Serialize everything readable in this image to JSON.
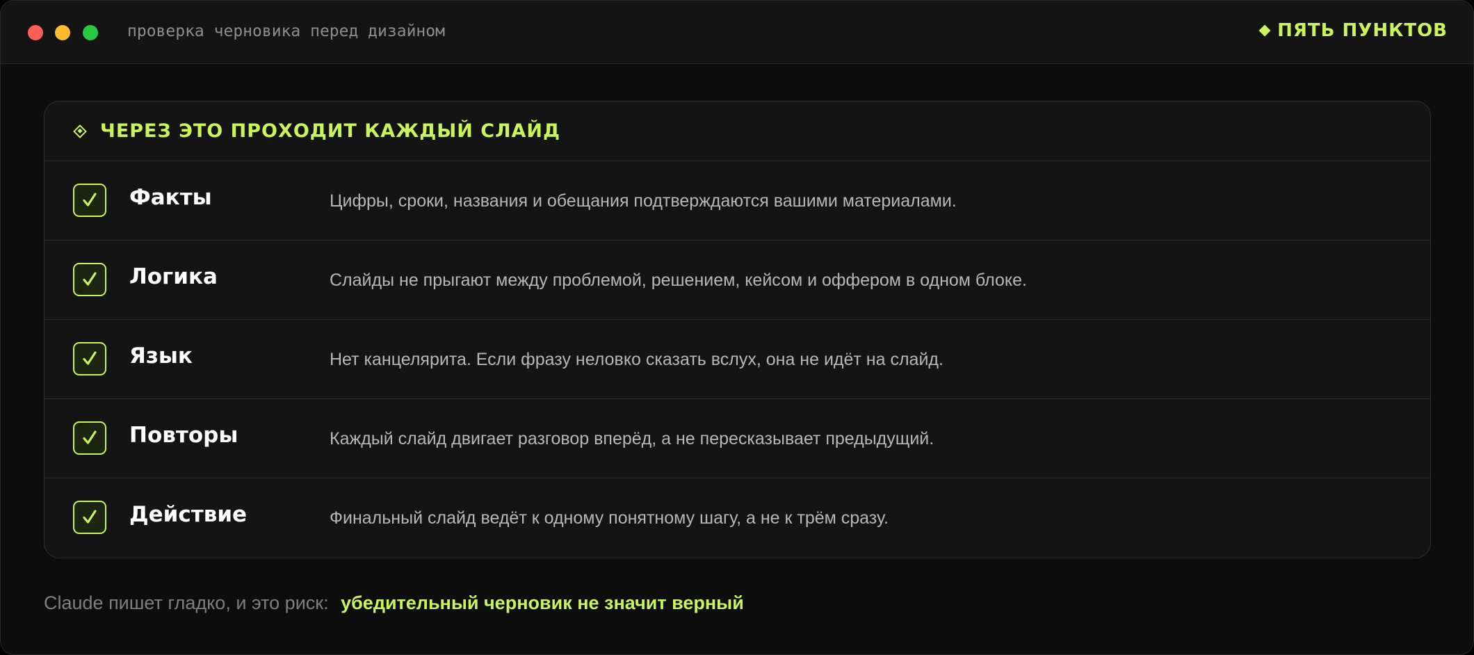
{
  "window": {
    "title": "проверка  черновика  перед  дизайном",
    "badge": "ПЯТЬ ПУНКТОВ"
  },
  "card": {
    "header": "ЧЕРЕЗ ЭТО ПРОХОДИТ КАЖДЫЙ СЛАЙД",
    "items": [
      {
        "title": "Факты",
        "description": "Цифры, сроки, названия и обещания подтверждаются вашими материалами.",
        "checked": true
      },
      {
        "title": "Логика",
        "description": "Слайды не прыгают между проблемой, решением, кейсом и оффером в одном блоке.",
        "checked": true
      },
      {
        "title": "Язык",
        "description": "Нет канцелярита. Если фразу неловко сказать вслух, она не идёт на слайд.",
        "checked": true
      },
      {
        "title": "Повторы",
        "description": "Каждый слайд двигает разговор вперёд, а не пересказывает предыдущий.",
        "checked": true
      },
      {
        "title": "Действие",
        "description": "Финальный слайд ведёт к одному понятному шагу, а не к трём сразу.",
        "checked": true
      }
    ]
  },
  "footer": {
    "muted": "Claude пишет гладко, и это риск:",
    "accent": "убедительный черновик не значит верный"
  },
  "colors": {
    "accent": "#c8f55a",
    "background": "#0d0d0d",
    "card": "#141414"
  },
  "icons": {
    "close": "close-dot",
    "minimize": "minimize-dot",
    "zoom": "zoom-dot",
    "badge": "diamond-icon",
    "header": "diamond-outline-icon",
    "item": "checkmark-icon"
  }
}
